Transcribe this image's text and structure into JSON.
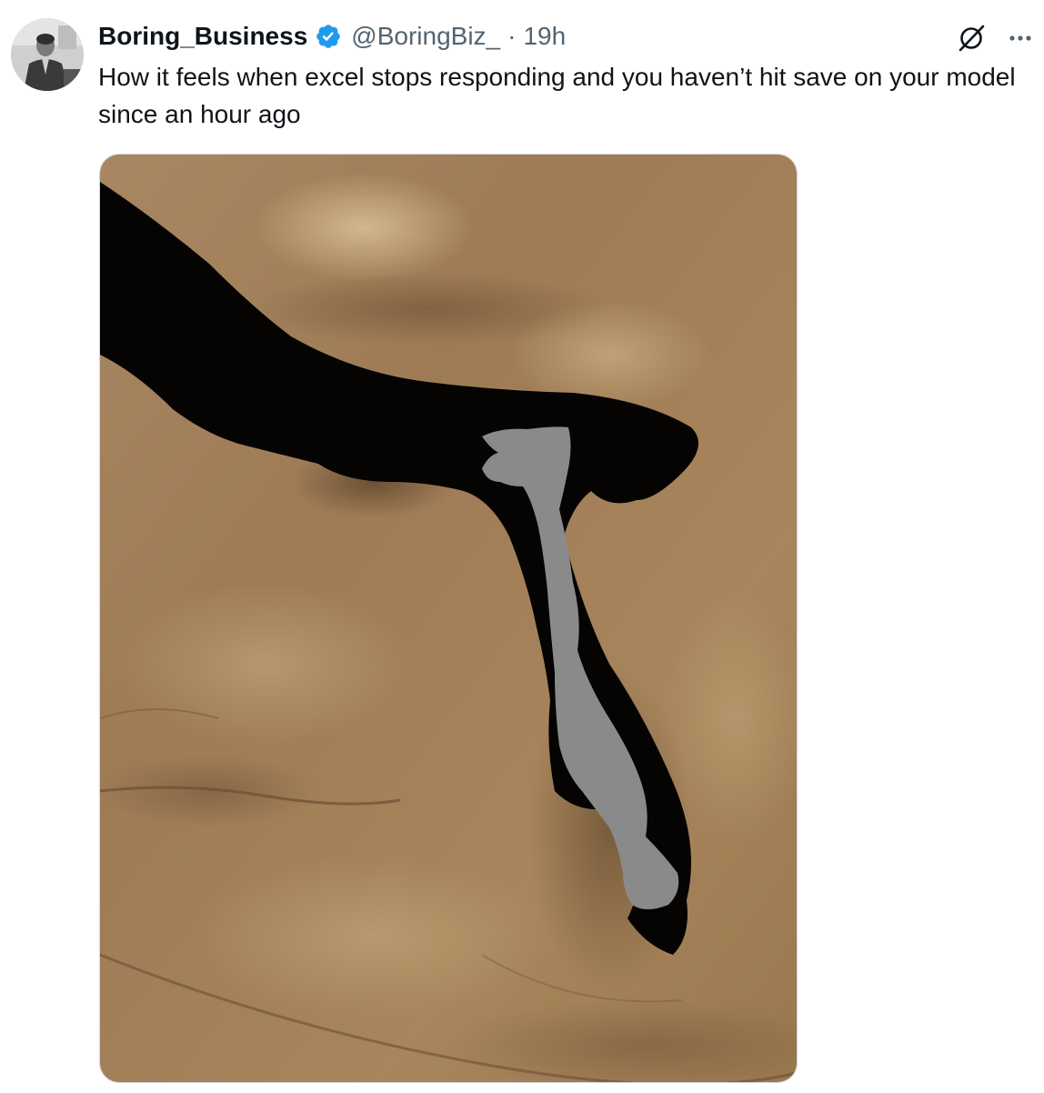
{
  "tweet": {
    "display_name": "Boring_Business",
    "handle": "@BoringBiz_",
    "separator": "·",
    "time": "19h",
    "text": "How it feels when excel stops responding and you haven’t hit save on your model since an hour ago"
  },
  "icons": {
    "verified": "verified-badge-icon",
    "grok": "grok-icon",
    "more": "more-options-icon"
  },
  "colors": {
    "verified_blue": "#1d9bf0",
    "secondary_text": "#536471",
    "primary_text": "#0f1419"
  }
}
